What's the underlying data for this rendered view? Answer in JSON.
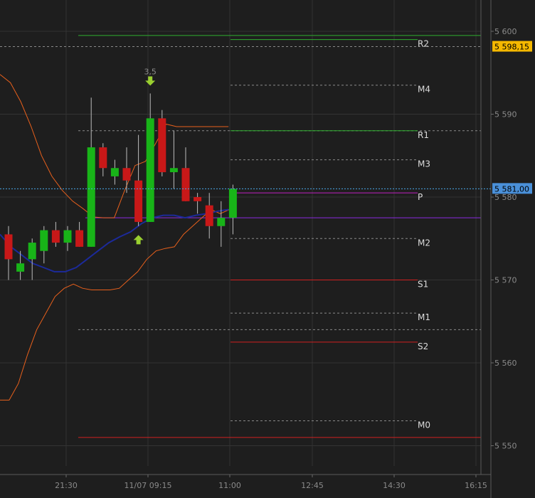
{
  "chart_data": {
    "type": "candlestick",
    "price_axis": {
      "ticks": [
        5550,
        5560,
        5570,
        5580,
        5590,
        5600
      ],
      "tick_labels": [
        "5 550",
        "5 560",
        "5 570",
        "5 580",
        "5 590",
        "5 600"
      ]
    },
    "time_axis": {
      "tick_labels": [
        "21:30",
        "11/07 09:15",
        "11:00",
        "12:45",
        "14:30",
        "16:15"
      ]
    },
    "price_tags": [
      {
        "label": "5 598,15",
        "value": 5598.15,
        "color": "#f5b800"
      },
      {
        "label": "5 581,00",
        "value": 5581.0,
        "color": "#4a90d9"
      }
    ],
    "candles": [
      {
        "open": 5575.5,
        "high": 5576.5,
        "low": 5570.0,
        "close": 5572.5
      },
      {
        "open": 5571.0,
        "high": 5573.5,
        "low": 5570.0,
        "close": 5572.0
      },
      {
        "open": 5572.5,
        "high": 5575.0,
        "low": 5570.0,
        "close": 5574.5
      },
      {
        "open": 5573.5,
        "high": 5576.5,
        "low": 5572.0,
        "close": 5576.0
      },
      {
        "open": 5576.0,
        "high": 5577.0,
        "low": 5574.0,
        "close": 5574.5
      },
      {
        "open": 5574.5,
        "high": 5576.5,
        "low": 5573.5,
        "close": 5576.0
      },
      {
        "open": 5576.0,
        "high": 5577.0,
        "low": 5574.0,
        "close": 5574.0
      },
      {
        "open": 5574.0,
        "high": 5592.0,
        "low": 5574.0,
        "close": 5586.0
      },
      {
        "open": 5586.0,
        "high": 5586.5,
        "low": 5582.5,
        "close": 5583.5
      },
      {
        "open": 5582.5,
        "high": 5584.5,
        "low": 5581.5,
        "close": 5583.5
      },
      {
        "open": 5583.5,
        "high": 5586.0,
        "low": 5580.5,
        "close": 5582.0
      },
      {
        "open": 5582.0,
        "high": 5587.5,
        "low": 5576.5,
        "close": 5577.0
      },
      {
        "open": 5577.0,
        "high": 5592.5,
        "low": 5577.0,
        "close": 5589.5
      },
      {
        "open": 5589.5,
        "high": 5590.5,
        "low": 5582.5,
        "close": 5583.0
      },
      {
        "open": 5583.0,
        "high": 5588.0,
        "low": 5581.0,
        "close": 5583.5
      },
      {
        "open": 5583.5,
        "high": 5586.0,
        "low": 5579.5,
        "close": 5579.5
      },
      {
        "open": 5580.0,
        "high": 5580.5,
        "low": 5578.0,
        "close": 5579.5
      },
      {
        "open": 5579.0,
        "high": 5580.5,
        "low": 5575.0,
        "close": 5576.5
      },
      {
        "open": 5576.5,
        "high": 5579.5,
        "low": 5574.0,
        "close": 5577.5
      },
      {
        "open": 5577.5,
        "high": 5581.5,
        "low": 5575.5,
        "close": 5581.0
      }
    ],
    "bollinger_upper": [
      5594.8,
      5593.8,
      5591.5,
      5588.5,
      5585.0,
      5582.5,
      5580.8,
      5579.5,
      5578.6,
      5577.6,
      5577.5,
      5577.5,
      5580.8,
      5583.8,
      5584.3,
      5586.5,
      5588.8,
      5588.5,
      5588.5,
      5588.5,
      5588.5,
      5588.5,
      5588.5
    ],
    "bollinger_lower": [
      5555.5,
      5555.5,
      5557.5,
      5561.0,
      5564.0,
      5566.0,
      5568.0,
      5569.0,
      5569.5,
      5569.0,
      5568.8,
      5568.8,
      5568.8,
      5569.0,
      5570.0,
      5571.0,
      5572.5,
      5573.5,
      5573.8,
      5574.0,
      5575.5,
      5576.5,
      5577.5,
      5578.5,
      5578.0,
      5578.5
    ],
    "moving_average": [
      5575.5,
      5574.0,
      5573.0,
      5572.0,
      5571.5,
      5571.0,
      5571.0,
      5571.5,
      5572.5,
      5573.5,
      5574.5,
      5575.2,
      5575.8,
      5576.8,
      5577.5,
      5577.8,
      5577.8,
      5577.5,
      5577.8,
      5578.0,
      5578.3,
      5578.5
    ],
    "pivot_levels": [
      {
        "name": "R2",
        "value": 5599.0,
        "style": "solid",
        "color": "#2fae2f",
        "show_label": true
      },
      {
        "name": "M4",
        "value": 5593.5,
        "style": "dashed",
        "color": "#8a8a8a",
        "show_label": true
      },
      {
        "name": "R1",
        "value": 5588.0,
        "style": "solid",
        "color": "#2fae2f",
        "show_label": true
      },
      {
        "name": "M3",
        "value": 5584.5,
        "style": "dashed",
        "color": "#8a8a8a",
        "show_label": true
      },
      {
        "name": "P",
        "value": 5580.5,
        "style": "solid",
        "color": "#c020c0",
        "show_label": true
      },
      {
        "name": "M2",
        "value": 5575.0,
        "style": "dashed",
        "color": "#8a8a8a",
        "show_label": true
      },
      {
        "name": "S1",
        "value": 5570.0,
        "style": "solid",
        "color": "#d02020",
        "show_label": true
      },
      {
        "name": "M1",
        "value": 5566.0,
        "style": "dashed",
        "color": "#8a8a8a",
        "show_label": true
      },
      {
        "name": "S2",
        "value": 5562.5,
        "style": "solid",
        "color": "#d02020",
        "show_label": true
      },
      {
        "name": "M0",
        "value": 5553.0,
        "style": "dashed",
        "color": "#8a8a8a",
        "show_label": true
      }
    ],
    "long_levels": [
      {
        "value": 5599.5,
        "style": "solid",
        "color": "#2fae2f"
      },
      {
        "value": 5598.15,
        "style": "dashed",
        "color": "#8a8a8a"
      },
      {
        "value": 5588.0,
        "style": "dashed",
        "color": "#8a8a8a"
      },
      {
        "value": 5577.5,
        "style": "solid",
        "color": "#8a2be2"
      },
      {
        "value": 5564.0,
        "style": "dashed",
        "color": "#8a8a8a"
      },
      {
        "value": 5551.0,
        "style": "solid",
        "color": "#d02020"
      }
    ],
    "signals": [
      {
        "direction": "down",
        "candle_index": 12,
        "label": "3,5",
        "value": 5592.5
      },
      {
        "direction": "up",
        "candle_index": 11,
        "label": "",
        "value": 5575.5
      }
    ],
    "grid": true,
    "colors": {
      "up": "#18b418",
      "down": "#c81818",
      "wick": "#bcbcbc",
      "bollinger": "#e8601c",
      "moving_average": "#1c2a9a",
      "grid": "#333333",
      "background": "#1e1e1e",
      "signal": "#9ad030",
      "crosshair": "#4aa8e8"
    }
  }
}
